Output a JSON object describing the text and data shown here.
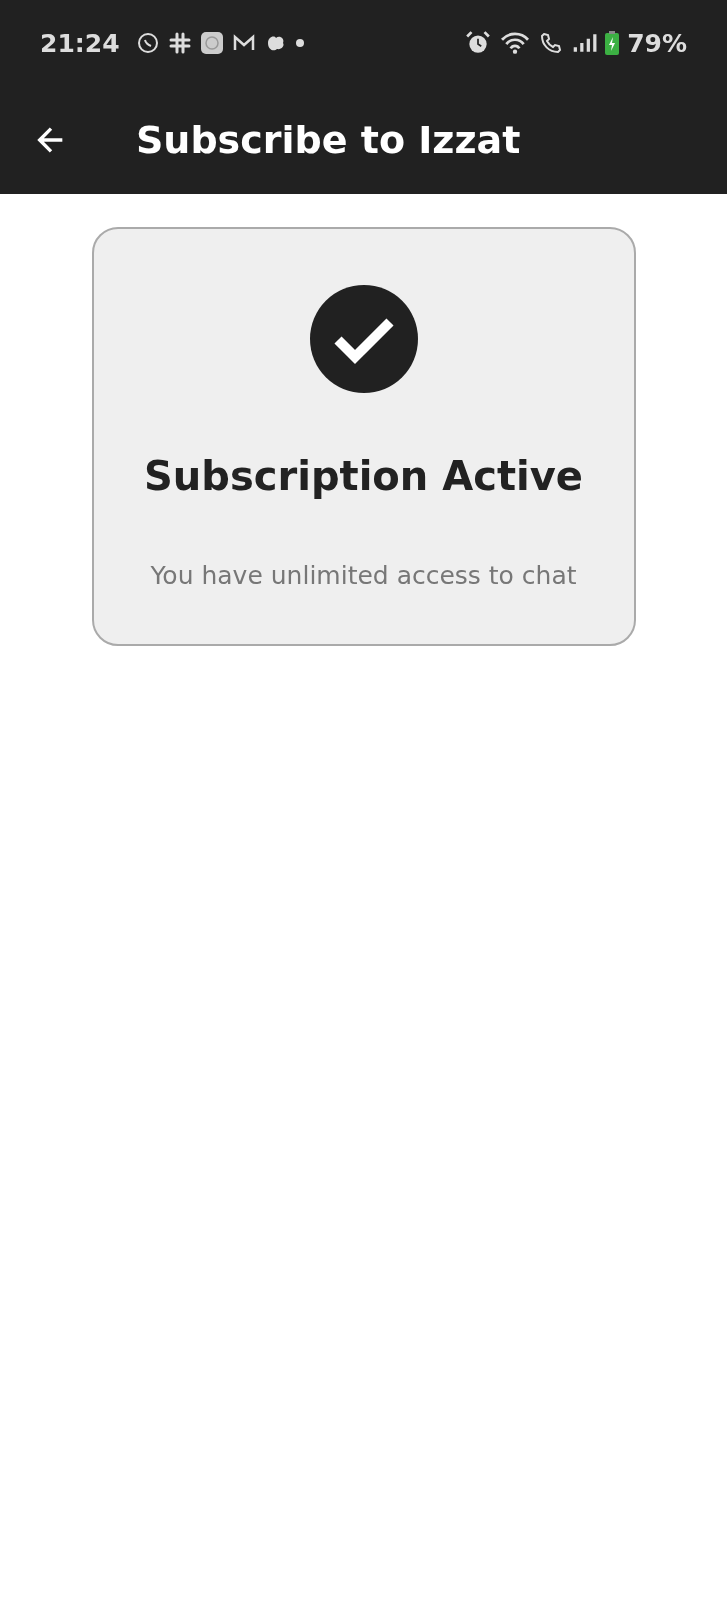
{
  "status_bar": {
    "time": "21:24",
    "battery": "79%"
  },
  "app_bar": {
    "title": "Subscribe to Izzat"
  },
  "card": {
    "title": "Subscription Active",
    "message": "You have unlimited access to chat"
  }
}
